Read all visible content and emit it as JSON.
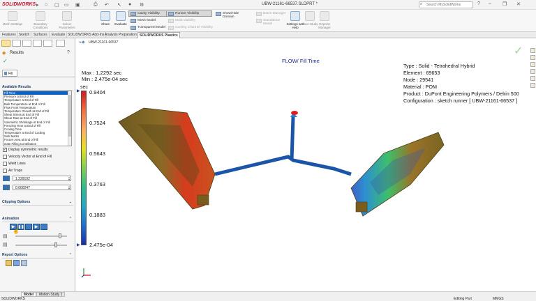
{
  "app": {
    "name": "SOLIDWORKS",
    "doc_title": "UBW-21161-66537.SLDPRT *",
    "search_placeholder": "Search MySolidWorks"
  },
  "ribbon": {
    "left_buttons": [
      "Mesh Settings",
      "Boundary Conditions",
      "Solver Parameters"
    ],
    "share": "Share",
    "evaluate": "Evaluate",
    "vis_col1": [
      "Cavity Visibility",
      "Mesh Model",
      "Transparent Model"
    ],
    "vis_col2": [
      "Runner Visibility",
      "Mold Visibility",
      "Cooling Channel Visibility"
    ],
    "show_hide": "Show/Hide Domain",
    "right_buttons": [
      "Batch Manager",
      "Standalone Model",
      "Settings and Help",
      "Save Study",
      "Reports Manager"
    ]
  },
  "tabs": [
    "Features",
    "Sketch",
    "Surfaces",
    "Evaluate",
    "SOLIDWORKS Add-Ins",
    "Analysis Preparation",
    "SOLIDWORKS Plastics"
  ],
  "panel": {
    "title": "Results",
    "fill_tab": "Fill",
    "available_results_header": "Available Results",
    "results": [
      "Fill Time",
      "Pressure at End of Fill",
      "Temperature at End of Fill",
      "Bulk Temperature at End of Fill",
      "Flow Front Temperature",
      "Temperature Growth at End of Fill",
      "Shear Stress at End of Fill",
      "Shear Rate at End of Fill",
      "Volumetric Shrinkage at End of Fill",
      "Freezing Time at End of Fill",
      "Cooling Time",
      "Temperature at End of Cooling",
      "Sink Marks",
      "Frozen Area at End of Fill",
      "Gate Filling Contribution"
    ],
    "display_symmetric": "Display symmetric results",
    "velocity_vector": "Velocity Vector at End of Fill",
    "weld_lines": "Weld Lines",
    "air_traps": "Air Traps",
    "max_value": "1.229192",
    "min_value": "0.000247",
    "clipping_header": "Clipping Options",
    "animation_header": "Animation",
    "report_header": "Report Options"
  },
  "viewport": {
    "tree_label": "UBW-21161-66537",
    "max_label": "Max : 1.2292 sec",
    "min_label": "Min : 2.475e-04 sec",
    "unit": "sec",
    "plot_title": "FLOW/ Fill Time",
    "legend_ticks": [
      "0.9404",
      "0.7524",
      "0.5643",
      "0.3763",
      "0.1883",
      "2.475e-04"
    ],
    "info": [
      "Type : Solid - Tetrahedral Hybrid",
      "Element : 69653",
      "Node : 29541",
      "Material : POM",
      "Product : DuPont Engineering Polymers / Delrin 500",
      "Configuration : sketch runner [ UBW-21161-66537 ]"
    ]
  },
  "status": {
    "app": "SOLIDWORKS",
    "tabs": [
      "Model",
      "Motion Study 1"
    ],
    "mode": "Editing Part",
    "units": "MMGS"
  },
  "colors": {
    "accent": "#c8102e",
    "selection": "#0a64c8",
    "section_header": "#1e3f66"
  }
}
